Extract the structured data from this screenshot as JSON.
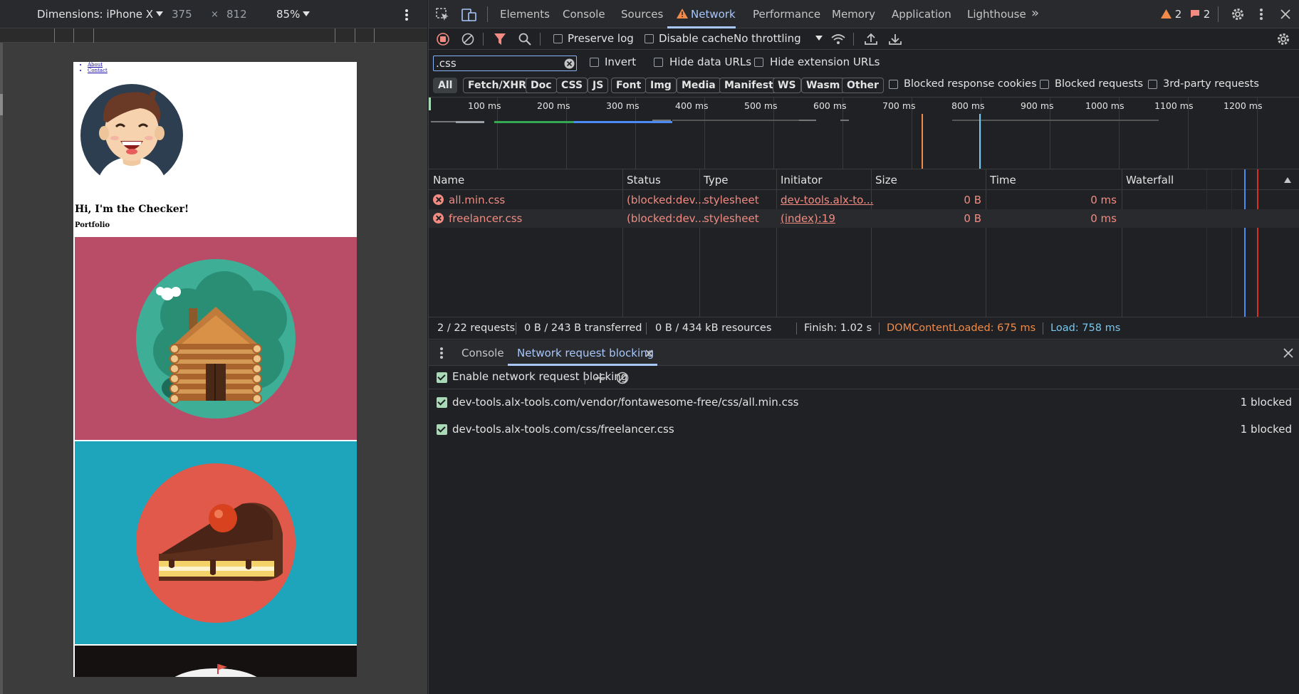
{
  "device_toolbar": {
    "dimensions_label": "Dimensions: iPhone X",
    "width": "375",
    "times": "×",
    "height": "812",
    "zoom": "85%"
  },
  "viewport_page": {
    "nav_items": [
      "About",
      "Contact"
    ],
    "hero_title": "Hi, I'm the Checker!",
    "hero_subtitle": "Portfolio"
  },
  "devtools_tabs": [
    "Elements",
    "Console",
    "Sources",
    "Network",
    "Performance",
    "Memory",
    "Application",
    "Lighthouse"
  ],
  "active_tab": "Network",
  "badges": {
    "warnings": "2",
    "errors": "2"
  },
  "network_toolbar": {
    "preserve_log": "Preserve log",
    "disable_cache": "Disable cache",
    "throttling": "No throttling"
  },
  "filter": {
    "value": ".css",
    "invert": "Invert",
    "hide_data_urls": "Hide data URLs",
    "hide_extension_urls": "Hide extension URLs"
  },
  "type_filters": [
    "All",
    "Fetch/XHR",
    "Doc",
    "CSS",
    "JS",
    "Font",
    "Img",
    "Media",
    "Manifest",
    "WS",
    "Wasm",
    "Other"
  ],
  "type_filter_selected": "All",
  "extra_filters": [
    "Blocked response cookies",
    "Blocked requests",
    "3rd-party requests"
  ],
  "timeline": {
    "ticks": [
      "100 ms",
      "200 ms",
      "300 ms",
      "400 ms",
      "500 ms",
      "600 ms",
      "700 ms",
      "800 ms",
      "900 ms",
      "1000 ms",
      "1100 ms",
      "1200 ms"
    ]
  },
  "table": {
    "columns": [
      "Name",
      "Status",
      "Type",
      "Initiator",
      "Size",
      "Time",
      "Waterfall"
    ],
    "rows": [
      {
        "name": "all.min.css",
        "status": "(blocked:dev...",
        "type": "stylesheet",
        "initiator": "dev-tools.alx-to...",
        "size": "0 B",
        "time": "0 ms"
      },
      {
        "name": "freelancer.css",
        "status": "(blocked:dev...",
        "type": "stylesheet",
        "initiator": "(index):19",
        "size": "0 B",
        "time": "0 ms"
      }
    ]
  },
  "summary": {
    "requests": "2 / 22 requests",
    "transferred": "0 B / 243 B transferred",
    "resources": "0 B / 434 kB resources",
    "finish": "Finish: 1.02 s",
    "domcontentloaded": "DOMContentLoaded: 675 ms",
    "load": "Load: 758 ms"
  },
  "drawer": {
    "tabs": [
      "Console",
      "Network request blocking"
    ],
    "enable_label": "Enable network request blocking",
    "patterns": [
      {
        "url": "dev-tools.alx-tools.com/vendor/fontawesome-free/css/all.min.css",
        "count": "1 blocked"
      },
      {
        "url": "dev-tools.alx-tools.com/css/freelancer.css",
        "count": "1 blocked"
      }
    ]
  },
  "colors": {
    "accent": "#a8c7fa",
    "error": "#f28b82",
    "domcontentloaded": "#f28b4a",
    "load": "#78c8f0",
    "checkbox_checked": "#a8dab5"
  }
}
